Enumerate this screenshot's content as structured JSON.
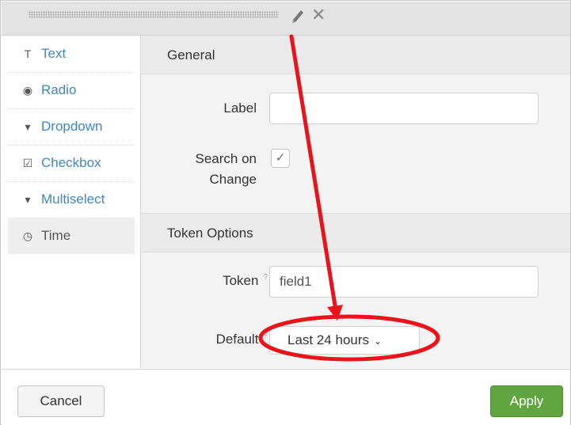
{
  "sidebar": {
    "items": [
      {
        "label": "Text",
        "icon": "text-type-icon",
        "glyph": "T"
      },
      {
        "label": "Radio",
        "icon": "radio-icon",
        "glyph": "◉"
      },
      {
        "label": "Dropdown",
        "icon": "caret-down-icon",
        "glyph": "▾"
      },
      {
        "label": "Checkbox",
        "icon": "checkbox-icon",
        "glyph": "☑"
      },
      {
        "label": "Multiselect",
        "icon": "caret-down-icon",
        "glyph": "▾"
      },
      {
        "label": "Time",
        "icon": "clock-icon",
        "glyph": "◷"
      }
    ],
    "selected": "Time"
  },
  "general": {
    "heading": "General",
    "label_field": {
      "label": "Label",
      "value": ""
    },
    "search_on_change": {
      "label_line1": "Search on",
      "label_line2": "Change",
      "checked": true,
      "mark": "✓"
    }
  },
  "token_options": {
    "heading": "Token Options",
    "token": {
      "label": "Token",
      "help": "?",
      "value": "field1"
    },
    "default": {
      "label": "Default",
      "help": "?",
      "value": "Last 24 hours",
      "chevron": "⌄"
    }
  },
  "footer": {
    "cancel_label": "Cancel",
    "apply_label": "Apply"
  },
  "window": {
    "close_glyph": "✕"
  },
  "annotation_color": "#e8141c"
}
